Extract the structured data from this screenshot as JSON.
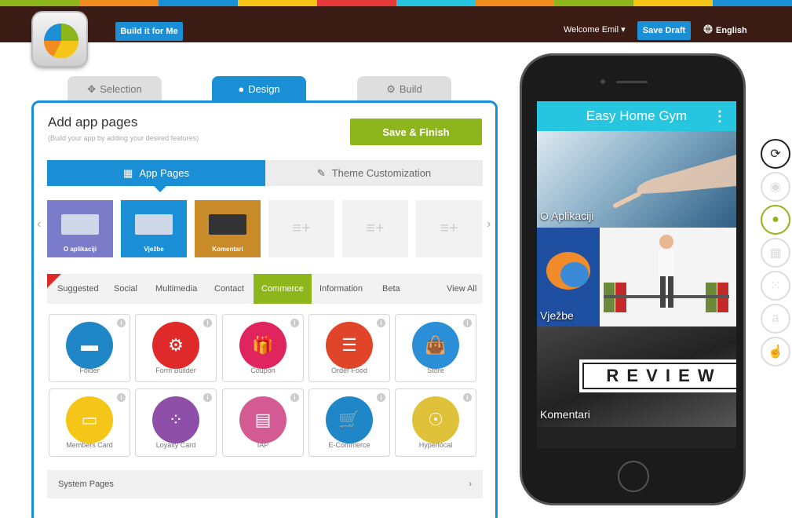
{
  "strip_colors": [
    "#8db51c",
    "#f28c1e",
    "#1a8fd6",
    "#f5c518",
    "#e83a3a",
    "#26c6e0",
    "#f28c1e",
    "#8db51c",
    "#f5c518",
    "#1a8fd6"
  ],
  "topbar": {
    "build_it_label": "Build it for Me",
    "welcome_label": "Welcome Emil ▾",
    "save_draft_label": "Save Draft",
    "language_label": "English"
  },
  "tabs": {
    "selection": "Selection",
    "design": "Design",
    "build": "Build"
  },
  "panel": {
    "title": "Add app pages",
    "subtitle": "(Build your app by adding your desired features)",
    "save_finish_label": "Save & Finish",
    "app_pages_label": "App Pages",
    "theme_label": "Theme Customization"
  },
  "page_tiles": [
    {
      "label": "O aplikaciji",
      "color": "#7a7bc9"
    },
    {
      "label": "Vježbe",
      "color": "#1a8fd6"
    },
    {
      "label": "Komentari",
      "color": "#c98a2a"
    }
  ],
  "empty_tile_symbol": "≡+",
  "categories": [
    "Suggested",
    "Social",
    "Multimedia",
    "Contact",
    "Commerce",
    "Information",
    "Beta",
    "View All"
  ],
  "active_category": "Commerce",
  "features": [
    {
      "label": "Folder",
      "color": "#1f86c7",
      "icon": "folder-icon",
      "glyph": "▬"
    },
    {
      "label": "Form Builder",
      "color": "#e02a2a",
      "icon": "gears-icon",
      "glyph": "⚙"
    },
    {
      "label": "Coupon",
      "color": "#e0245e",
      "icon": "gift-icon",
      "glyph": "🎁"
    },
    {
      "label": "Order Food",
      "color": "#e0452a",
      "icon": "burger-icon",
      "glyph": "☰"
    },
    {
      "label": "Store",
      "color": "#2a8fd6",
      "icon": "shopping-bag-icon",
      "glyph": "👜"
    },
    {
      "label": "Members Card",
      "color": "#f5c518",
      "icon": "credit-card-icon",
      "glyph": "▭"
    },
    {
      "label": "Loyalty Card",
      "color": "#8e4fa8",
      "icon": "dots-grid-icon",
      "glyph": "⁘"
    },
    {
      "label": "IAP",
      "color": "#d45a93",
      "icon": "document-icon",
      "glyph": "▤"
    },
    {
      "label": "E-Commerce",
      "color": "#1f86c7",
      "icon": "cart-icon",
      "glyph": "🛒"
    },
    {
      "label": "Hyperlocal",
      "color": "#e0c23a",
      "icon": "location-person-icon",
      "glyph": "☉"
    }
  ],
  "system_pages_label": "System Pages",
  "phone": {
    "app_title": "Easy Home Gym",
    "tiles": [
      {
        "label": "O Aplikaciji"
      },
      {
        "label": "Vježbe"
      },
      {
        "label": "Komentari",
        "banner": "R E V I E W"
      }
    ]
  },
  "platforms": [
    "refresh-icon",
    "android-icon",
    "apple-icon",
    "windows-icon",
    "blackberry-icon",
    "amazon-icon",
    "touch-icon"
  ],
  "active_platform": "apple-icon"
}
